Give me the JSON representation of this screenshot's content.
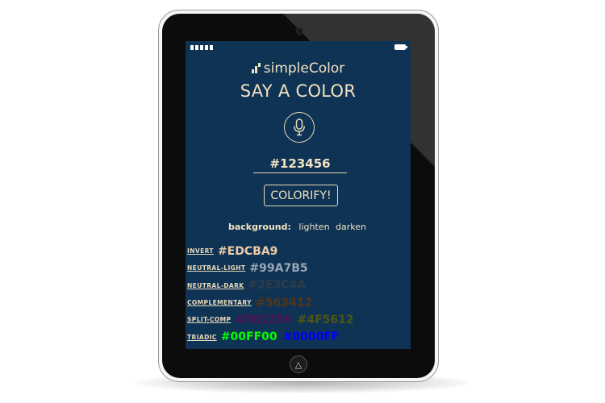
{
  "app": {
    "logo_text": "simpleColor",
    "headline": "SAY A COLOR"
  },
  "input": {
    "value": "#123456"
  },
  "colorify_label": "COLORIFY!",
  "background": {
    "label": "background:",
    "lighten": "lighten",
    "darken": "darken"
  },
  "schemes": {
    "invert": {
      "label": "INVERT",
      "values": [
        "#EDCBA9"
      ],
      "colors": [
        "#EDCBA9"
      ]
    },
    "neutral_light": {
      "label": "NEUTRAL-LIGHT",
      "values": [
        "#99A7B5"
      ],
      "colors": [
        "#99A7B5"
      ]
    },
    "neutral_dark": {
      "label": "NEUTRAL-DARK",
      "values": [
        "#2E3C4A"
      ],
      "colors": [
        "#2E3C4A"
      ]
    },
    "complementary": {
      "label": "COMPLEMENTARY",
      "values": [
        "#563412"
      ],
      "colors": [
        "#563412"
      ]
    },
    "split_comp": {
      "label": "SPLIT-COMP",
      "values": [
        "#561256",
        "#4F5612"
      ],
      "colors": [
        "#561256",
        "#4F5612"
      ]
    },
    "triadic": {
      "label": "TRIADIC",
      "values": [
        "#00FF00",
        "#0000FF"
      ],
      "colors": [
        "#00FF00",
        "#0000FF"
      ]
    }
  },
  "theme": {
    "screen_bg": "#0F3354",
    "text": "#F1E2C2"
  },
  "icons": {
    "mic": "microphone-icon",
    "logo": "logo-bars-icon",
    "home": "home-triangle-icon"
  }
}
